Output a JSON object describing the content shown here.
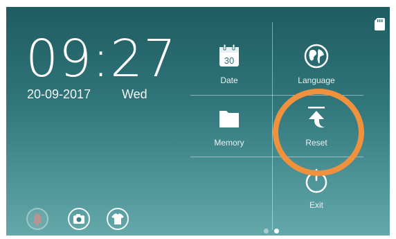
{
  "clock": {
    "time": "09:27",
    "date": "20-09-2017",
    "weekday": "Wed"
  },
  "status": {
    "sd_card_icon": "sd-card-icon"
  },
  "menu": {
    "date_label": "Date",
    "date_icon_number": "30",
    "language_label": "Language",
    "memory_label": "Memory",
    "reset_label": "Reset",
    "exit_label": "Exit"
  },
  "bottom_bar": {
    "icons": [
      "bell-icon",
      "camera-icon",
      "shirt-icon"
    ]
  },
  "pagination": {
    "total": 2,
    "current": 2
  },
  "colors": {
    "highlight": "#f0923d",
    "background_top": "#1f5c61",
    "background_bottom": "#64a8aa"
  }
}
